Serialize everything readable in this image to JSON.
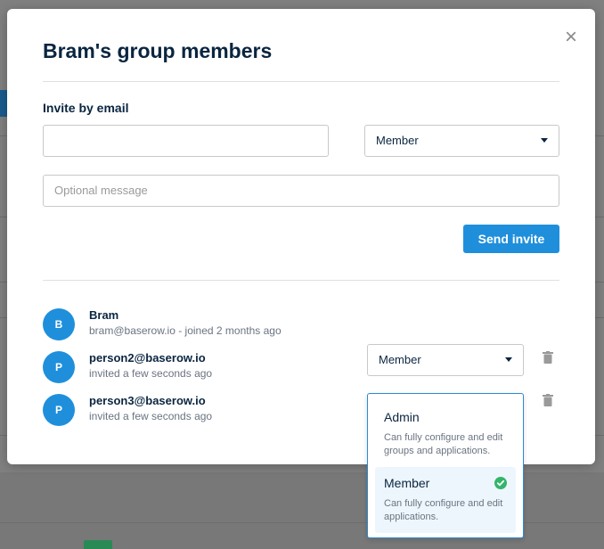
{
  "modal": {
    "title": "Bram's group members",
    "close_label": "×"
  },
  "invite": {
    "section_label": "Invite by email",
    "email_value": "",
    "email_placeholder": "",
    "role_value": "Member",
    "message_placeholder": "Optional message",
    "send_label": "Send invite"
  },
  "members": [
    {
      "initial": "B",
      "name": "Bram",
      "subtitle": "bram@baserow.io - joined 2 months ago",
      "role": ""
    },
    {
      "initial": "P",
      "name": "person2@baserow.io",
      "subtitle": "invited a few seconds ago",
      "role": "Member"
    },
    {
      "initial": "P",
      "name": "person3@baserow.io",
      "subtitle": "invited a few seconds ago",
      "role": ""
    }
  ],
  "dropdown": {
    "options": [
      {
        "label": "Admin",
        "description": "Can fully configure and edit groups and applications.",
        "selected": false
      },
      {
        "label": "Member",
        "description": "Can fully configure and edit applications.",
        "selected": true
      }
    ]
  },
  "colors": {
    "primary": "#1f8fdc",
    "text": "#0a2540",
    "check": "#33b56b"
  },
  "icons": {
    "close": "close-icon",
    "caret": "chevron-down-icon",
    "trash": "trash-icon",
    "check": "check-circle-icon"
  }
}
